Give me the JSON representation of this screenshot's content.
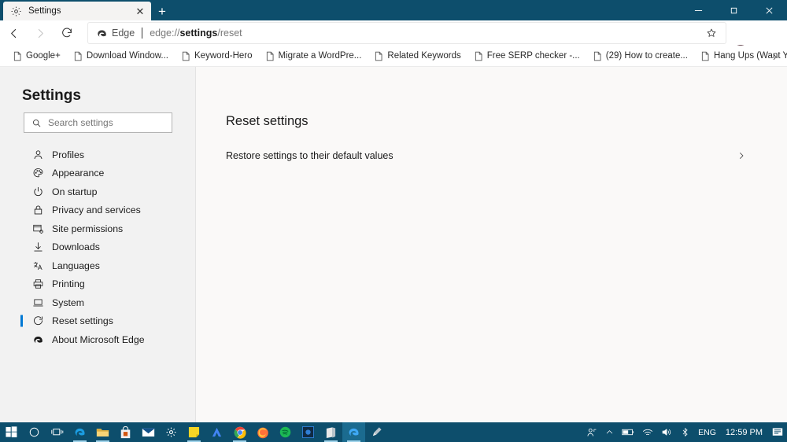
{
  "window": {
    "title": "Settings",
    "accent_color": "#0d4e6c",
    "active_indicator_color": "#0078d4"
  },
  "tab": {
    "title": "Settings",
    "icon": "gear-icon",
    "close_label": "✕",
    "new_tab_label": "+"
  },
  "window_controls": {
    "minimize": "minimize-button",
    "maximize": "maximize-button",
    "close": "close-button"
  },
  "toolbar": {
    "back": "back-button",
    "forward": "forward-button",
    "refresh": "refresh-button",
    "omnibox": {
      "brand": "Edge",
      "url_prefix": "edge://",
      "url_bold": "settings",
      "url_suffix": "/reset",
      "full_url": "edge://settings/reset",
      "star": "favorite-icon"
    },
    "profile": "avatar",
    "more": "…"
  },
  "bookmarks": {
    "items": [
      {
        "label": "Google+"
      },
      {
        "label": "Download Window..."
      },
      {
        "label": "Keyword-Hero"
      },
      {
        "label": "Migrate a WordPre..."
      },
      {
        "label": "Related Keywords"
      },
      {
        "label": "Free SERP checker -..."
      },
      {
        "label": "(29) How to create..."
      },
      {
        "label": "Hang Ups (Want Yo..."
      }
    ],
    "overflow": "chevron-right-icon"
  },
  "sidebar": {
    "title": "Settings",
    "search": {
      "placeholder": "Search settings",
      "value": ""
    },
    "items": [
      {
        "label": "Profiles",
        "icon": "person-icon",
        "active": false
      },
      {
        "label": "Appearance",
        "icon": "palette-icon",
        "active": false
      },
      {
        "label": "On startup",
        "icon": "power-icon",
        "active": false
      },
      {
        "label": "Privacy and services",
        "icon": "lock-icon",
        "active": false
      },
      {
        "label": "Site permissions",
        "icon": "site-permissions-icon",
        "active": false
      },
      {
        "label": "Downloads",
        "icon": "download-icon",
        "active": false
      },
      {
        "label": "Languages",
        "icon": "languages-icon",
        "active": false
      },
      {
        "label": "Printing",
        "icon": "printer-icon",
        "active": false
      },
      {
        "label": "System",
        "icon": "laptop-icon",
        "active": false
      },
      {
        "label": "Reset settings",
        "icon": "reset-icon",
        "active": true
      },
      {
        "label": "About Microsoft Edge",
        "icon": "edge-logo-icon",
        "active": false
      }
    ]
  },
  "main": {
    "heading": "Reset settings",
    "restore_row": {
      "label": "Restore settings to their default values",
      "chevron": "chevron-right-icon"
    }
  },
  "taskbar": {
    "apps": [
      {
        "name": "start-button"
      },
      {
        "name": "cortana-search"
      },
      {
        "name": "task-view"
      },
      {
        "name": "edge-taskbar"
      },
      {
        "name": "file-explorer"
      },
      {
        "name": "microsoft-store"
      },
      {
        "name": "mail"
      },
      {
        "name": "settings-app"
      },
      {
        "name": "sticky-notes"
      },
      {
        "name": "google-ads"
      },
      {
        "name": "google-chrome"
      },
      {
        "name": "mozilla-firefox"
      },
      {
        "name": "spotify"
      },
      {
        "name": "blue-app"
      },
      {
        "name": "notebook-app"
      },
      {
        "name": "edge-active"
      },
      {
        "name": "paint-3d"
      }
    ],
    "tray": {
      "people": "people-icon",
      "show_hidden": "chevron-up-icon",
      "battery": "battery-icon",
      "network": "wifi-icon",
      "volume": "volume-icon",
      "bluetooth": "bluetooth-icon",
      "language": "ENG",
      "clock": "12:59 PM",
      "action_center": "notification-icon"
    }
  }
}
